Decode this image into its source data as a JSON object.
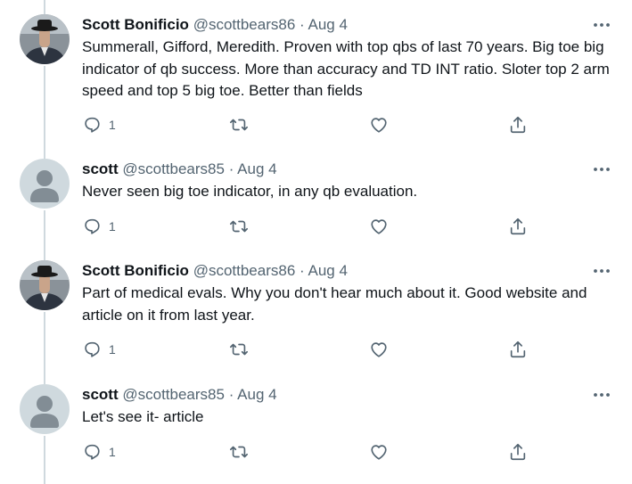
{
  "tweets": [
    {
      "name": "Scott Bonificio",
      "handle": "@scottbears86",
      "sep": "·",
      "date": "Aug 4",
      "avatar": "photo-avatar",
      "text": "Summerall, Gifford, Meredith. Proven with top qbs of last 70 years. Big toe big indicator of qb success. More than accuracy and TD INT ratio. Sloter top 2 arm speed and top 5 big toe. Better than fields",
      "reply_count": "1"
    },
    {
      "name": "scott",
      "handle": "@scottbears85",
      "sep": "·",
      "date": "Aug 4",
      "avatar": "default-avatar",
      "text": "Never seen big toe indicator, in any qb evaluation.",
      "reply_count": "1"
    },
    {
      "name": "Scott Bonificio",
      "handle": "@scottbears86",
      "sep": "·",
      "date": "Aug 4",
      "avatar": "photo-avatar",
      "text": "Part of medical evals. Why you don't hear much about it. Good website and article on it from last year.",
      "reply_count": "1"
    },
    {
      "name": "scott",
      "handle": "@scottbears85",
      "sep": "·",
      "date": "Aug 4",
      "avatar": "default-avatar",
      "text": "Let's see it- article",
      "reply_count": "1"
    }
  ],
  "icons": {
    "more": "more-horizontal-icon",
    "reply": "reply-icon",
    "retweet": "retweet-icon",
    "like": "heart-icon",
    "share": "share-icon"
  },
  "colors": {
    "text": "#0f1419",
    "muted": "#536471",
    "thread_line": "#cfd9de",
    "default_avatar_bg": "#cfd9de",
    "default_avatar_fg": "#828d95"
  }
}
